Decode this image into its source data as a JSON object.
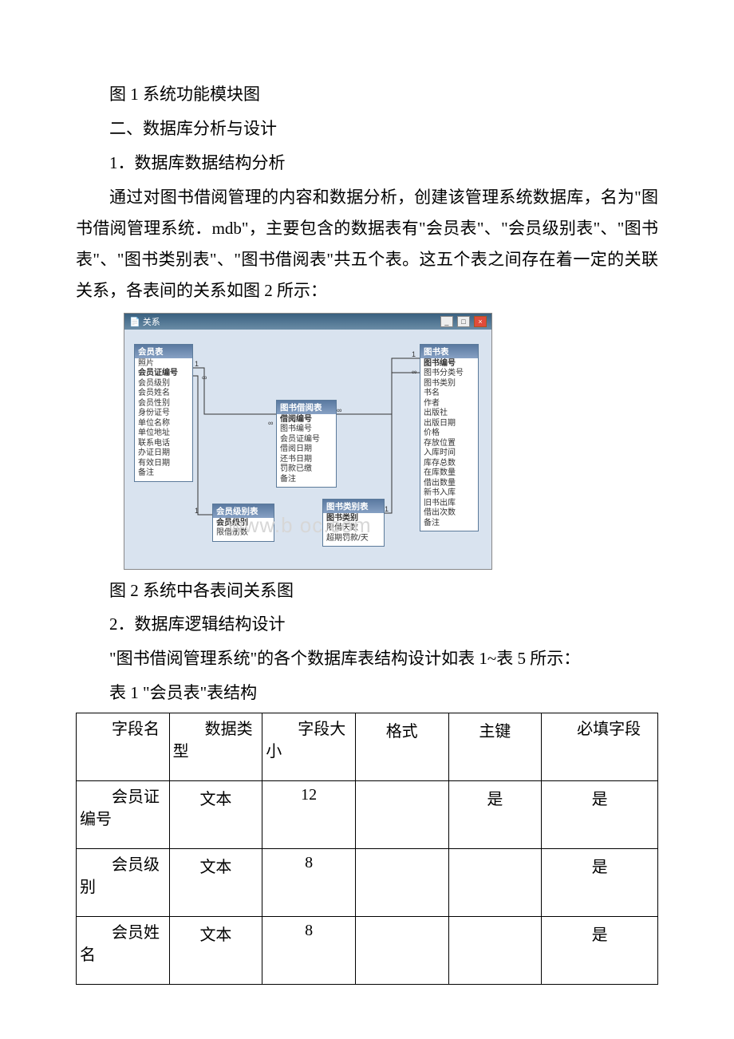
{
  "captions": {
    "fig1": "图 1 系统功能模块图",
    "sec2": "二、数据库分析与设计",
    "sec2_1": "1．数据库数据结构分析",
    "body1": "通过对图书借阅管理的内容和数据分析，创建该管理系统数据库，名为\"图书借阅管理系统．mdb\"，主要包含的数据表有\"会员表\"、\"会员级别表\"、\"图书表\"、\"图书类别表\"、\"图书借阅表\"共五个表。这五个表之间存在着一定的关联关系，各表间的关系如图 2 所示：",
    "fig2": "图 2 系统中各表间关系图",
    "sec2_2": "2．数据库逻辑结构设计",
    "body2": "\"图书借阅管理系统\"的各个数据库表结构设计如表 1~表 5 所示：",
    "tbl1": "表 1 \"会员表\"表结构"
  },
  "rel_window": {
    "title": "关系",
    "watermark": "www.b    oc.com",
    "tables": {
      "member": {
        "title": "会员表",
        "fields": [
          "照片",
          "会员证编号",
          "会员级别",
          "会员姓名",
          "会员性别",
          "身份证号",
          "单位名称",
          "单位地址",
          "联系电话",
          "办证日期",
          "有效日期",
          "备注"
        ],
        "pk_index": 1
      },
      "member_level": {
        "title": "会员级别表",
        "fields": [
          "会员级别",
          "限借册数"
        ],
        "pk_index": 0
      },
      "borrow": {
        "title": "图书借阅表",
        "fields": [
          "借阅编号",
          "图书编号",
          "会员证编号",
          "借阅日期",
          "还书日期",
          "罚款已缴",
          "备注"
        ],
        "pk_index": 0
      },
      "book_cat": {
        "title": "图书类别表",
        "fields": [
          "图书类别",
          "限借天数",
          "超期罚款/天"
        ],
        "pk_index": 0
      },
      "book": {
        "title": "图书表",
        "fields": [
          "图书编号",
          "图书分类号",
          "图书类别",
          "书名",
          "作者",
          "出版社",
          "出版日期",
          "价格",
          "存放位置",
          "入库时间",
          "库存总数",
          "在库数量",
          "借出数量",
          "新书入库",
          "旧书出库",
          "借出次数",
          "备注"
        ],
        "pk_index": 0
      }
    },
    "rel_symbols": {
      "one": "1",
      "many": "∞"
    }
  },
  "schema_table": {
    "headers": [
      "字段名",
      "数据类型",
      "字段大小",
      "格式",
      "主键",
      "必填字段"
    ],
    "rows": [
      [
        "会员证编号",
        "文本",
        "12",
        "",
        "是",
        "是"
      ],
      [
        "会员级别",
        "文本",
        "8",
        "",
        "",
        "是"
      ],
      [
        "会员姓名",
        "文本",
        "8",
        "",
        "",
        "是"
      ]
    ]
  }
}
